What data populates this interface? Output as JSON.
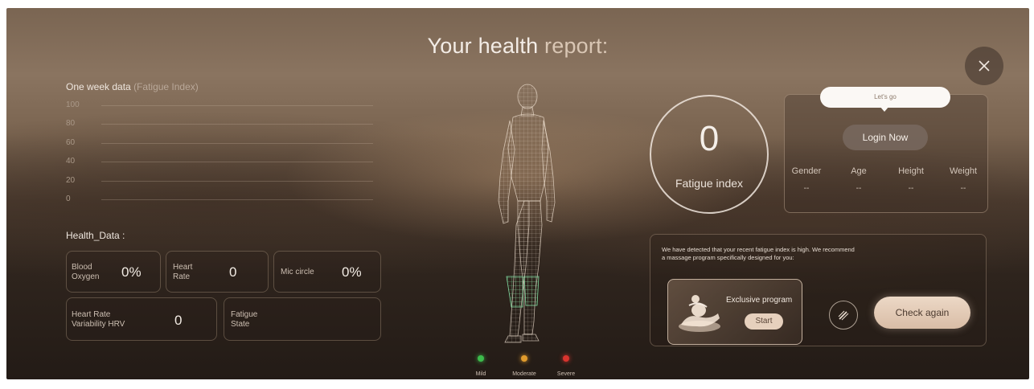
{
  "header": {
    "title_main": "Your health",
    "title_accent": "report:"
  },
  "chart": {
    "title_main": "One week data",
    "title_accent": "(Fatigue Index)",
    "y_ticks": [
      "100",
      "80",
      "60",
      "40",
      "20",
      "0"
    ]
  },
  "chart_data": {
    "type": "line",
    "title": "One week data (Fatigue Index)",
    "ylim": [
      0,
      100
    ],
    "y_ticks": [
      100,
      80,
      60,
      40,
      20,
      0
    ],
    "grid": true,
    "series": []
  },
  "health_data": {
    "section_title": "Health_Data :",
    "blood_oxygen": {
      "label_l1": "Blood",
      "label_l2": "Oxygen",
      "value": "0%"
    },
    "heart_rate": {
      "label_l1": "Heart",
      "label_l2": "Rate",
      "value": "0"
    },
    "micro_circle": {
      "label": "Mic circle",
      "value": "0%"
    },
    "hrv": {
      "label_l1": "Heart Rate",
      "label_l2": "Variability HRV",
      "value": "0"
    },
    "fatigue_state": {
      "label_l1": "Fatigue",
      "label_l2": "State",
      "value": ""
    }
  },
  "legend": [
    {
      "label": "Mild",
      "color": "#3dbb4c"
    },
    {
      "label": "Moderate",
      "color": "#e09b2d"
    },
    {
      "label": "Severe",
      "color": "#d8342e"
    }
  ],
  "fatigue": {
    "value": "0",
    "label": "Fatigue index"
  },
  "profile": {
    "tooltip": "Let's go",
    "login_label": "Login Now",
    "stats": [
      {
        "label": "Gender",
        "value": "--"
      },
      {
        "label": "Age",
        "value": "--"
      },
      {
        "label": "Height",
        "value": "--"
      },
      {
        "label": "Weight",
        "value": "--"
      }
    ]
  },
  "recommendation": {
    "line1": "We have detected that your recent fatigue index is high. We recommend",
    "line2": "a massage program specifically designed for you:",
    "program_title": "Exclusive program",
    "start_label": "Start",
    "check_again_label": "Check again"
  },
  "icons": {
    "close": "close-icon",
    "edit": "edit-icon",
    "program": "massage-icon",
    "body": "body-model-icon"
  }
}
